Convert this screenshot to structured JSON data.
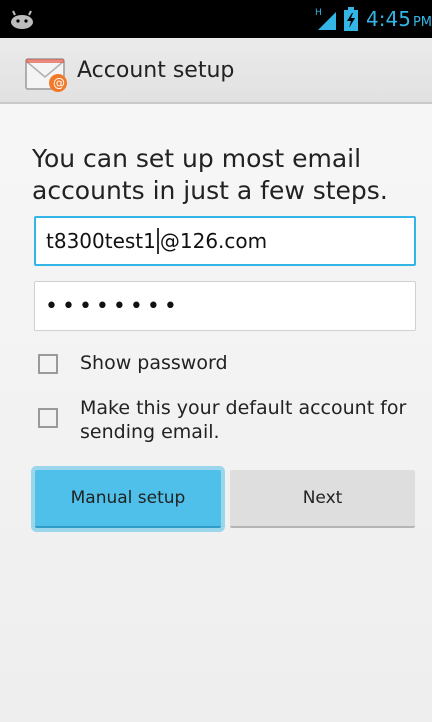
{
  "status_bar": {
    "left_icon": "android-notification-icon",
    "signal_label": "H",
    "signal_icon": "signal-strength-icon",
    "battery_icon": "battery-charging-icon",
    "time": "4:45",
    "ampm": "PM",
    "accent_color": "#33b5e5"
  },
  "action_bar": {
    "icon": "email-app-icon",
    "title": "Account setup"
  },
  "intro_text": "You can set up most email accounts in just a few steps.",
  "form": {
    "email_value_before_cursor": "t8300test1",
    "email_value_after_cursor": "@126.com",
    "password_masked": "••••••••"
  },
  "checkboxes": {
    "show_password_label": "Show password",
    "show_password_checked": false,
    "default_account_label": "Make this your default account for sending email.",
    "default_account_checked": false
  },
  "buttons": {
    "manual_setup": "Manual setup",
    "next": "Next",
    "focused_color": "#4fc0ea"
  }
}
